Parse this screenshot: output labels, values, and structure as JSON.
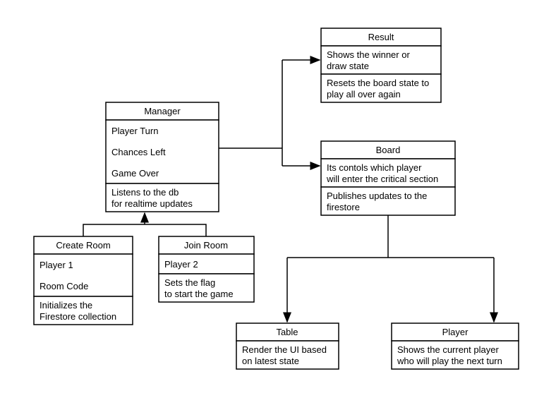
{
  "manager": {
    "title": "Manager",
    "l1": "Player Turn",
    "l2": "Chances Left",
    "l3": "Game Over",
    "f1": "Listens to the db",
    "f2": "for realtime updates"
  },
  "createRoom": {
    "title": "Create Room",
    "l1": "Player 1",
    "l2": "Room Code",
    "f1": "Initializes the",
    "f2": "Firestore collection"
  },
  "joinRoom": {
    "title": "Join Room",
    "l1": "Player 2",
    "f1": "Sets the flag",
    "f2": "to start the game"
  },
  "result": {
    "title": "Result",
    "l1": "Shows the winner or",
    "l2": "draw state",
    "f1": "Resets the board state to",
    "f2": "play all over again"
  },
  "board": {
    "title": "Board",
    "l1": "Its contols which player",
    "l2": "will enter the critical section",
    "f1": "Publishes updates to the",
    "f2": "firestore"
  },
  "table": {
    "title": "Table",
    "f1": "Render the UI based",
    "f2": "on latest state"
  },
  "player": {
    "title": "Player",
    "f1": "Shows the current player",
    "f2": "who will play the next turn"
  }
}
